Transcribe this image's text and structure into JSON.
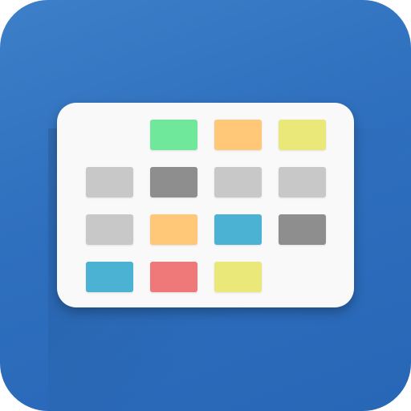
{
  "app_icon": {
    "name": "calendar-grid-app-icon",
    "background_color": "#2e6fbe",
    "card_color": "#f9f9f9",
    "cells": [
      {
        "name": "cell-empty",
        "color": null
      },
      {
        "name": "cell-green",
        "color": "#6fe89c"
      },
      {
        "name": "cell-orange",
        "color": "#fec878"
      },
      {
        "name": "cell-yellow",
        "color": "#e9e878"
      },
      {
        "name": "cell-light-gray",
        "color": "#c8c8c8"
      },
      {
        "name": "cell-dark-gray",
        "color": "#8e8e8e"
      },
      {
        "name": "cell-light-gray",
        "color": "#c8c8c8"
      },
      {
        "name": "cell-light-gray",
        "color": "#c8c8c8"
      },
      {
        "name": "cell-light-gray",
        "color": "#c8c8c8"
      },
      {
        "name": "cell-orange",
        "color": "#fec878"
      },
      {
        "name": "cell-blue",
        "color": "#4bb2d3"
      },
      {
        "name": "cell-dark-gray",
        "color": "#8e8e8e"
      },
      {
        "name": "cell-blue",
        "color": "#4bb2d3"
      },
      {
        "name": "cell-red",
        "color": "#ef7878"
      },
      {
        "name": "cell-yellow",
        "color": "#e9e878"
      },
      {
        "name": "cell-empty",
        "color": null
      }
    ]
  }
}
